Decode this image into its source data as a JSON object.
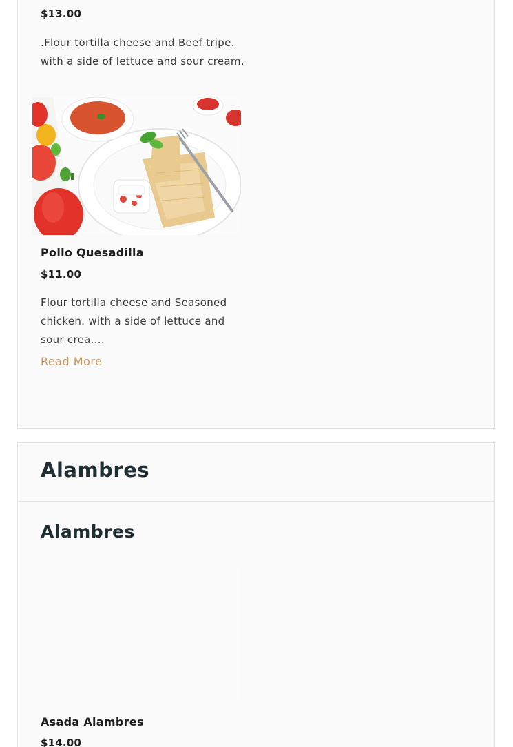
{
  "top_menu": {
    "prev_item": {
      "price": "$13.00",
      "description": ".Flour tortilla cheese and Beef tripe. with a side of lettuce and sour cream."
    },
    "item": {
      "name": "Pollo Quesadilla",
      "price": "$11.00",
      "description": "Flour tortilla cheese and Seasoned chicken. with a side of lettuce and sour crea....",
      "read_more": "Read More"
    }
  },
  "alambres_section": {
    "header_title": "Alambres",
    "category_title": "Alambres",
    "item": {
      "name": "Asada Alambres",
      "price": "$14.00"
    }
  },
  "colors": {
    "read_more": "#c9955b",
    "heading": "#1f2e33",
    "card_bg": "#fafafa",
    "border": "#e3e3e3"
  }
}
